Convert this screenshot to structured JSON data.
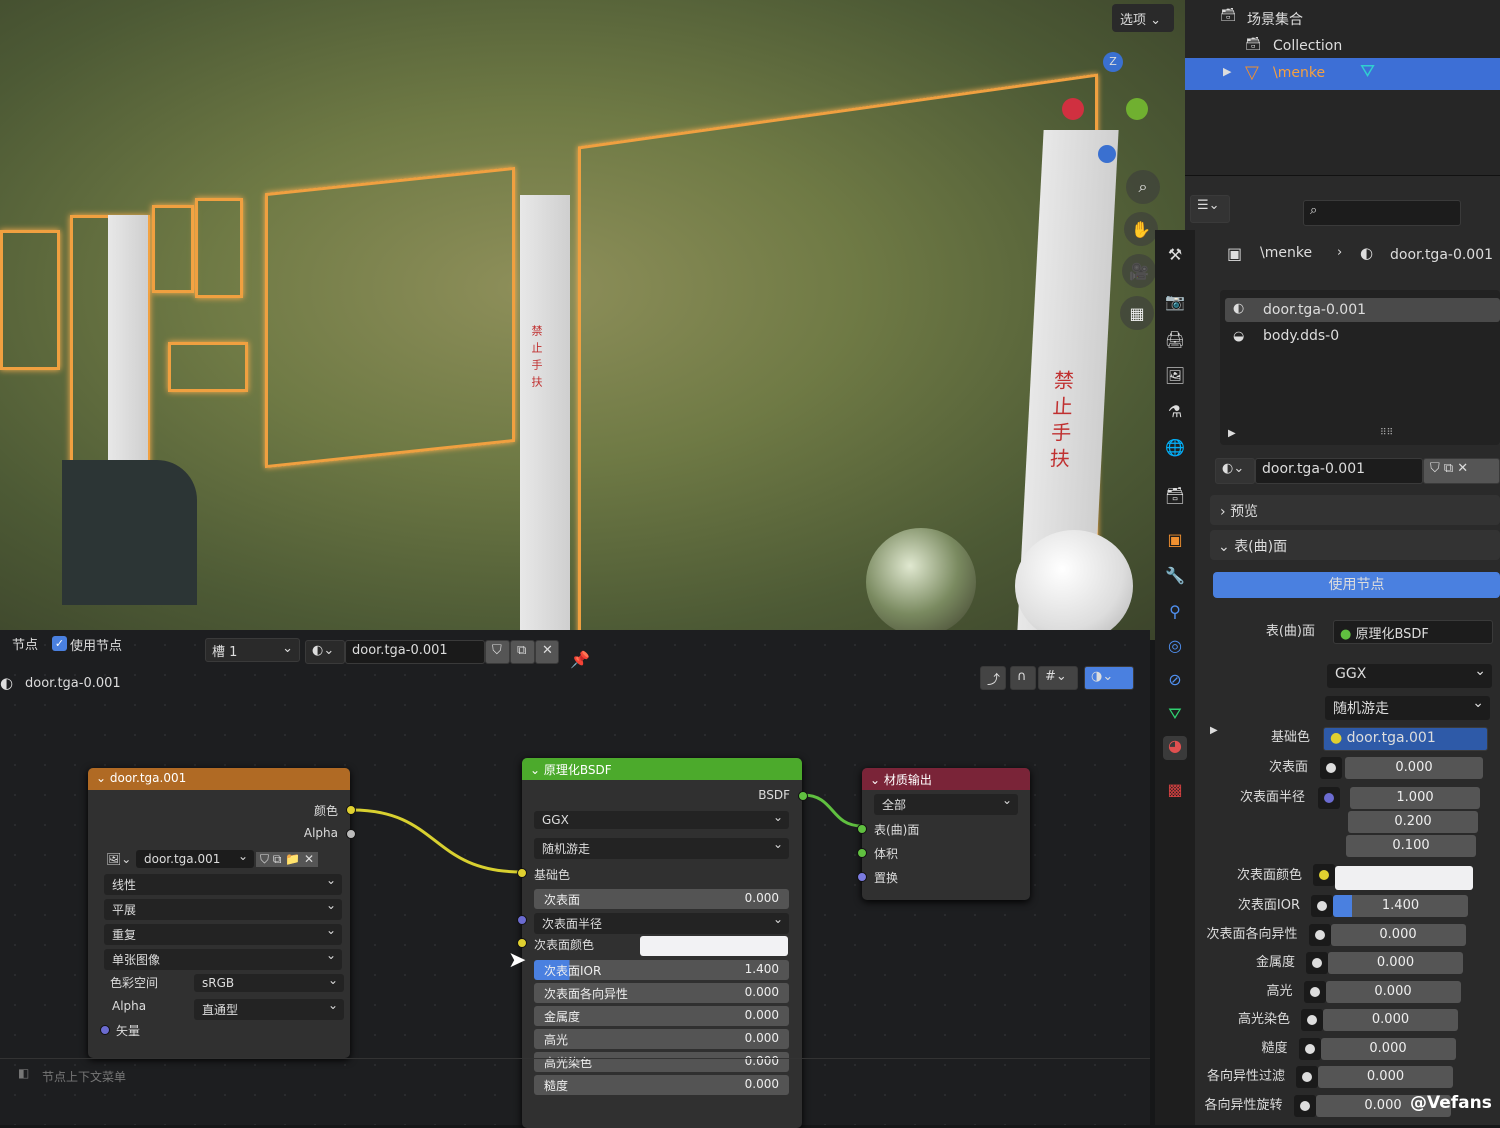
{
  "viewport": {
    "options_label": "选项",
    "sign_text": "禁止手扶",
    "gizmo_z": "Z"
  },
  "node_editor": {
    "header": {
      "menu_node": "节点",
      "use_nodes_label": "使用节点",
      "use_nodes_checked": true,
      "slot": "槽 1",
      "material": "door.tga-0.001"
    },
    "breadcrumb": "door.tga-0.001",
    "status": "节点上下文菜单",
    "image_node": {
      "title": "door.tga.001",
      "out_color": "颜色",
      "out_alpha": "Alpha",
      "image": "door.tga.001",
      "interpolation": "线性",
      "projection": "平展",
      "extension": "重复",
      "source": "单张图像",
      "colorspace_label": "色彩空间",
      "colorspace": "sRGB",
      "alpha_label": "Alpha",
      "alpha": "直通型",
      "in_vector": "矢量"
    },
    "bsdf_node": {
      "title": "原理化BSDF",
      "out": "BSDF",
      "distribution": "GGX",
      "subsurface_method": "随机游走",
      "base_color": "基础色",
      "subsurface_radius": "次表面半径",
      "subsurface_color": "次表面颜色",
      "sliders": [
        {
          "label": "次表面",
          "value": "0.000"
        },
        {
          "label": "次表面IOR",
          "value": "1.400"
        },
        {
          "label": "次表面各向异性",
          "value": "0.000"
        },
        {
          "label": "金属度",
          "value": "0.000"
        },
        {
          "label": "高光",
          "value": "0.000"
        },
        {
          "label": "高光染色",
          "value": "0.000"
        },
        {
          "label": "糙度",
          "value": "0.000"
        }
      ]
    },
    "output_node": {
      "title": "材质输出",
      "target": "全部",
      "inputs": [
        "表(曲)面",
        "体积",
        "置换"
      ]
    }
  },
  "outliner": {
    "scene_collection": "场景集合",
    "collection": "Collection",
    "object": "\\menke"
  },
  "properties": {
    "breadcrumb_object": "\\menke",
    "breadcrumb_material": "door.tga-0.001",
    "slots": [
      "door.tga-0.001",
      "body.dds-0"
    ],
    "material": "door.tga-0.001",
    "preview_panel": "预览",
    "surface_panel": "表(曲)面",
    "use_nodes_button": "使用节点",
    "surface_label": "表(曲)面",
    "surface_value": "原理化BSDF",
    "distribution": "GGX",
    "subsurface_method": "随机游走",
    "base_color_label": "基础色",
    "base_color_value": "door.tga.001",
    "subsurface_label": "次表面",
    "subsurface_value": "0.000",
    "radius_label": "次表面半径",
    "radius": [
      "1.000",
      "0.200",
      "0.100"
    ],
    "sss_color_label": "次表面颜色",
    "rows": [
      {
        "label": "次表面IOR",
        "value": "1.400"
      },
      {
        "label": "次表面各向异性",
        "value": "0.000"
      },
      {
        "label": "金属度",
        "value": "0.000"
      },
      {
        "label": "高光",
        "value": "0.000"
      },
      {
        "label": "高光染色",
        "value": "0.000"
      },
      {
        "label": "糙度",
        "value": "0.000"
      },
      {
        "label": "各向异性过滤",
        "value": "0.000"
      },
      {
        "label": "各向异性旋转",
        "value": "0.000"
      }
    ]
  },
  "watermark": "@Vefans"
}
